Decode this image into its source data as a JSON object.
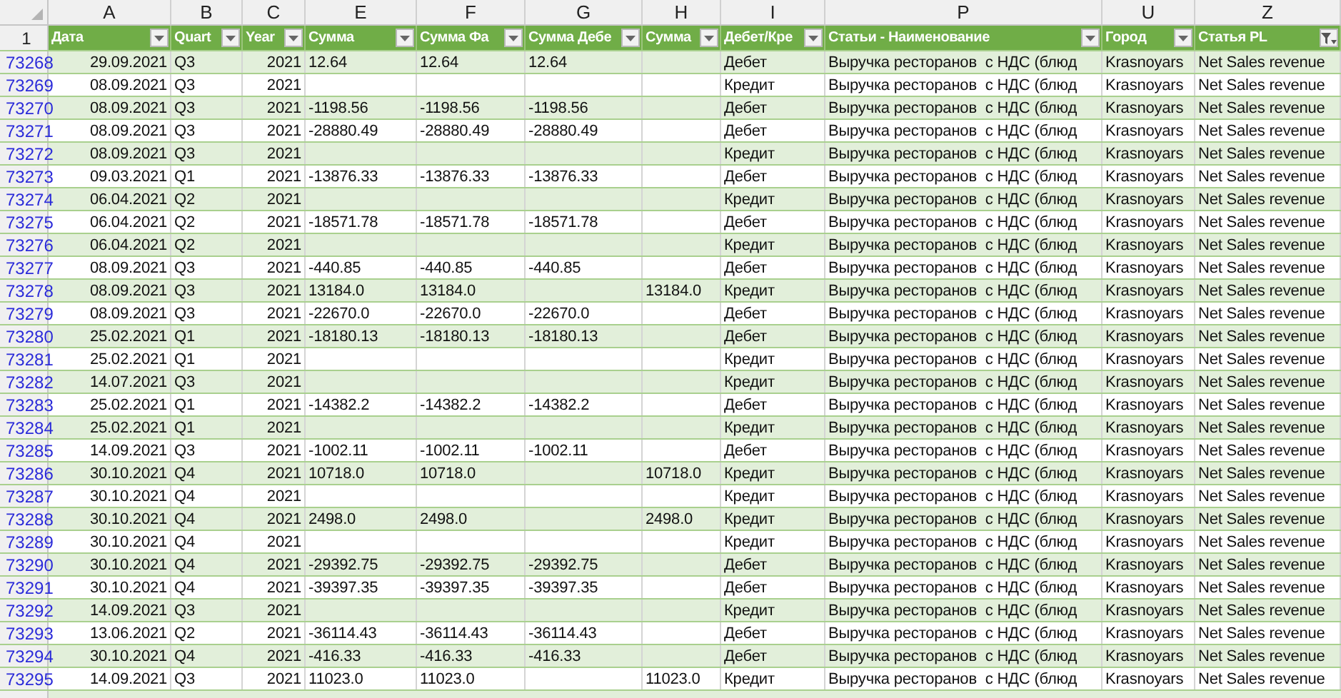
{
  "corner_row_label": "1",
  "columns": [
    {
      "letter": "A",
      "header": "Дата",
      "kind": "date",
      "filtered": false
    },
    {
      "letter": "B",
      "header": "Quart",
      "kind": "text",
      "filtered": false
    },
    {
      "letter": "C",
      "header": "Year",
      "kind": "number",
      "filtered": false
    },
    {
      "letter": "E",
      "header": "Сумма",
      "kind": "text",
      "filtered": false
    },
    {
      "letter": "F",
      "header": "Сумма Фа",
      "kind": "text",
      "filtered": false
    },
    {
      "letter": "G",
      "header": "Сумма Дебе",
      "kind": "text",
      "filtered": false
    },
    {
      "letter": "H",
      "header": "Сумма",
      "kind": "text",
      "filtered": false
    },
    {
      "letter": "I",
      "header": "Дебет/Кре",
      "kind": "text",
      "filtered": false
    },
    {
      "letter": "P",
      "header": "Статьи - Наименование",
      "kind": "text",
      "filtered": false
    },
    {
      "letter": "U",
      "header": "Город",
      "kind": "text",
      "filtered": false
    },
    {
      "letter": "Z",
      "header": "Статья PL",
      "kind": "text",
      "filtered": true
    }
  ],
  "rows": [
    {
      "row": "73268",
      "cells": [
        "29.09.2021",
        "Q3",
        "2021",
        "12.64",
        "12.64",
        "12.64",
        null,
        "Дебет",
        "Выручка ресторанов  с НДС (блюд",
        "Krasnoyars",
        "Net Sales revenue"
      ]
    },
    {
      "row": "73269",
      "cells": [
        "08.09.2021",
        "Q3",
        "2021",
        null,
        null,
        null,
        null,
        "Кредит",
        "Выручка ресторанов  с НДС (блюд",
        "Krasnoyars",
        "Net Sales revenue"
      ]
    },
    {
      "row": "73270",
      "cells": [
        "08.09.2021",
        "Q3",
        "2021",
        "-1198.56",
        "-1198.56",
        "-1198.56",
        null,
        "Дебет",
        "Выручка ресторанов  с НДС (блюд",
        "Krasnoyars",
        "Net Sales revenue"
      ]
    },
    {
      "row": "73271",
      "cells": [
        "08.09.2021",
        "Q3",
        "2021",
        "-28880.49",
        "-28880.49",
        "-28880.49",
        null,
        "Дебет",
        "Выручка ресторанов  с НДС (блюд",
        "Krasnoyars",
        "Net Sales revenue"
      ]
    },
    {
      "row": "73272",
      "cells": [
        "08.09.2021",
        "Q3",
        "2021",
        null,
        null,
        null,
        null,
        "Кредит",
        "Выручка ресторанов  с НДС (блюд",
        "Krasnoyars",
        "Net Sales revenue"
      ]
    },
    {
      "row": "73273",
      "cells": [
        "09.03.2021",
        "Q1",
        "2021",
        "-13876.33",
        "-13876.33",
        "-13876.33",
        null,
        "Дебет",
        "Выручка ресторанов  с НДС (блюд",
        "Krasnoyars",
        "Net Sales revenue"
      ]
    },
    {
      "row": "73274",
      "cells": [
        "06.04.2021",
        "Q2",
        "2021",
        null,
        null,
        null,
        null,
        "Кредит",
        "Выручка ресторанов  с НДС (блюд",
        "Krasnoyars",
        "Net Sales revenue"
      ]
    },
    {
      "row": "73275",
      "cells": [
        "06.04.2021",
        "Q2",
        "2021",
        "-18571.78",
        "-18571.78",
        "-18571.78",
        null,
        "Дебет",
        "Выручка ресторанов  с НДС (блюд",
        "Krasnoyars",
        "Net Sales revenue"
      ]
    },
    {
      "row": "73276",
      "cells": [
        "06.04.2021",
        "Q2",
        "2021",
        null,
        null,
        null,
        null,
        "Кредит",
        "Выручка ресторанов  с НДС (блюд",
        "Krasnoyars",
        "Net Sales revenue"
      ]
    },
    {
      "row": "73277",
      "cells": [
        "08.09.2021",
        "Q3",
        "2021",
        "-440.85",
        "-440.85",
        "-440.85",
        null,
        "Дебет",
        "Выручка ресторанов  с НДС (блюд",
        "Krasnoyars",
        "Net Sales revenue"
      ]
    },
    {
      "row": "73278",
      "cells": [
        "08.09.2021",
        "Q3",
        "2021",
        "13184.0",
        "13184.0",
        null,
        "13184.0",
        "Кредит",
        "Выручка ресторанов  с НДС (блюд",
        "Krasnoyars",
        "Net Sales revenue"
      ]
    },
    {
      "row": "73279",
      "cells": [
        "08.09.2021",
        "Q3",
        "2021",
        "-22670.0",
        "-22670.0",
        "-22670.0",
        null,
        "Дебет",
        "Выручка ресторанов  с НДС (блюд",
        "Krasnoyars",
        "Net Sales revenue"
      ]
    },
    {
      "row": "73280",
      "cells": [
        "25.02.2021",
        "Q1",
        "2021",
        "-18180.13",
        "-18180.13",
        "-18180.13",
        null,
        "Дебет",
        "Выручка ресторанов  с НДС (блюд",
        "Krasnoyars",
        "Net Sales revenue"
      ]
    },
    {
      "row": "73281",
      "cells": [
        "25.02.2021",
        "Q1",
        "2021",
        null,
        null,
        null,
        null,
        "Кредит",
        "Выручка ресторанов  с НДС (блюд",
        "Krasnoyars",
        "Net Sales revenue"
      ]
    },
    {
      "row": "73282",
      "cells": [
        "14.07.2021",
        "Q3",
        "2021",
        null,
        null,
        null,
        null,
        "Кредит",
        "Выручка ресторанов  с НДС (блюд",
        "Krasnoyars",
        "Net Sales revenue"
      ]
    },
    {
      "row": "73283",
      "cells": [
        "25.02.2021",
        "Q1",
        "2021",
        "-14382.2",
        "-14382.2",
        "-14382.2",
        null,
        "Дебет",
        "Выручка ресторанов  с НДС (блюд",
        "Krasnoyars",
        "Net Sales revenue"
      ]
    },
    {
      "row": "73284",
      "cells": [
        "25.02.2021",
        "Q1",
        "2021",
        null,
        null,
        null,
        null,
        "Кредит",
        "Выручка ресторанов  с НДС (блюд",
        "Krasnoyars",
        "Net Sales revenue"
      ]
    },
    {
      "row": "73285",
      "cells": [
        "14.09.2021",
        "Q3",
        "2021",
        "-1002.11",
        "-1002.11",
        "-1002.11",
        null,
        "Дебет",
        "Выручка ресторанов  с НДС (блюд",
        "Krasnoyars",
        "Net Sales revenue"
      ]
    },
    {
      "row": "73286",
      "cells": [
        "30.10.2021",
        "Q4",
        "2021",
        "10718.0",
        "10718.0",
        null,
        "10718.0",
        "Кредит",
        "Выручка ресторанов  с НДС (блюд",
        "Krasnoyars",
        "Net Sales revenue"
      ]
    },
    {
      "row": "73287",
      "cells": [
        "30.10.2021",
        "Q4",
        "2021",
        null,
        null,
        null,
        null,
        "Кредит",
        "Выручка ресторанов  с НДС (блюд",
        "Krasnoyars",
        "Net Sales revenue"
      ]
    },
    {
      "row": "73288",
      "cells": [
        "30.10.2021",
        "Q4",
        "2021",
        "2498.0",
        "2498.0",
        null,
        "2498.0",
        "Кредит",
        "Выручка ресторанов  с НДС (блюд",
        "Krasnoyars",
        "Net Sales revenue"
      ]
    },
    {
      "row": "73289",
      "cells": [
        "30.10.2021",
        "Q4",
        "2021",
        null,
        null,
        null,
        null,
        "Кредит",
        "Выручка ресторанов  с НДС (блюд",
        "Krasnoyars",
        "Net Sales revenue"
      ]
    },
    {
      "row": "73290",
      "cells": [
        "30.10.2021",
        "Q4",
        "2021",
        "-29392.75",
        "-29392.75",
        "-29392.75",
        null,
        "Дебет",
        "Выручка ресторанов  с НДС (блюд",
        "Krasnoyars",
        "Net Sales revenue"
      ]
    },
    {
      "row": "73291",
      "cells": [
        "30.10.2021",
        "Q4",
        "2021",
        "-39397.35",
        "-39397.35",
        "-39397.35",
        null,
        "Дебет",
        "Выручка ресторанов  с НДС (блюд",
        "Krasnoyars",
        "Net Sales revenue"
      ]
    },
    {
      "row": "73292",
      "cells": [
        "14.09.2021",
        "Q3",
        "2021",
        null,
        null,
        null,
        null,
        "Кредит",
        "Выручка ресторанов  с НДС (блюд",
        "Krasnoyars",
        "Net Sales revenue"
      ]
    },
    {
      "row": "73293",
      "cells": [
        "13.06.2021",
        "Q2",
        "2021",
        "-36114.43",
        "-36114.43",
        "-36114.43",
        null,
        "Дебет",
        "Выручка ресторанов  с НДС (блюд",
        "Krasnoyars",
        "Net Sales revenue"
      ]
    },
    {
      "row": "73294",
      "cells": [
        "30.10.2021",
        "Q4",
        "2021",
        "-416.33",
        "-416.33",
        "-416.33",
        null,
        "Дебет",
        "Выручка ресторанов  с НДС (блюд",
        "Krasnoyars",
        "Net Sales revenue"
      ]
    },
    {
      "row": "73295",
      "cells": [
        "14.09.2021",
        "Q3",
        "2021",
        "11023.0",
        "11023.0",
        null,
        "11023.0",
        "Кредит",
        "Выручка ресторанов  с НДС (блюд",
        "Krasnoyars",
        "Net Sales revenue"
      ]
    }
  ]
}
